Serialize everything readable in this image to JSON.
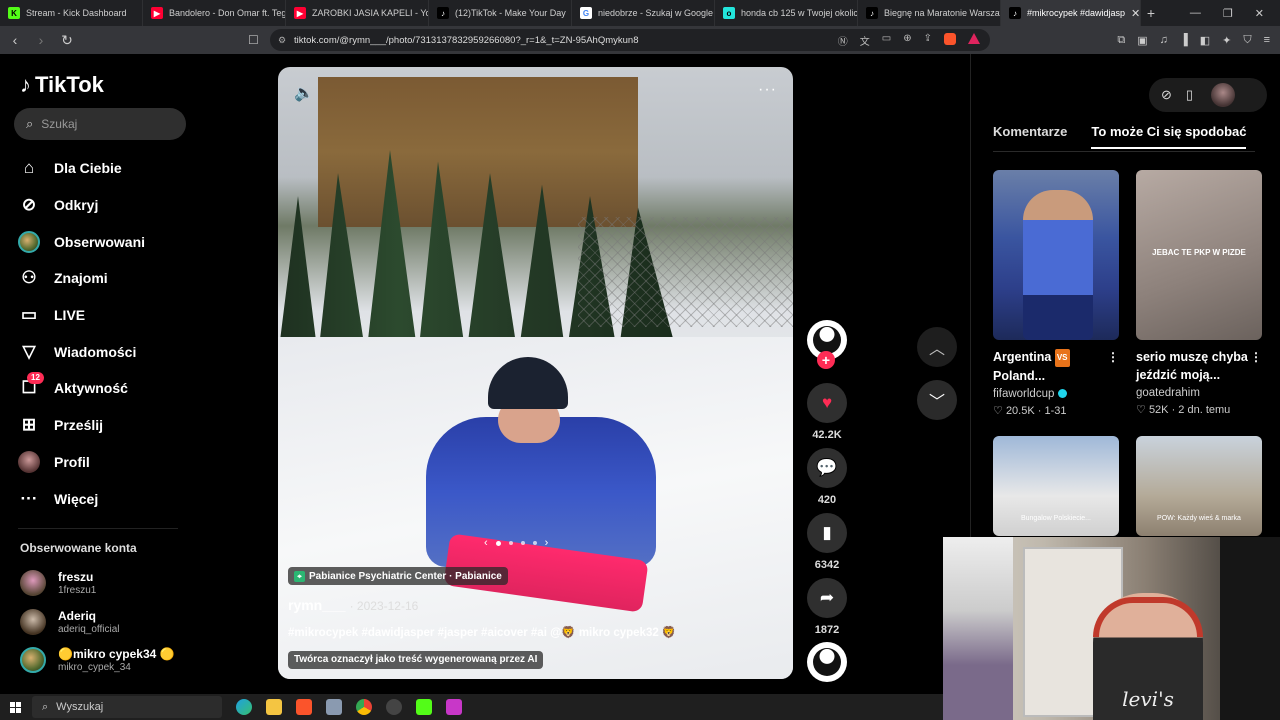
{
  "browser": {
    "tabs": [
      {
        "title": "Stream - Kick Dashboard",
        "color": "#53fc18",
        "glyph": "K"
      },
      {
        "title": "Bandolero - Don Omar ft. Tego",
        "color": "#ff0033",
        "glyph": "▶"
      },
      {
        "title": "ZAROBKI JASIA KAPELI - YouTu",
        "color": "#ff0033",
        "glyph": "▶"
      },
      {
        "title": "(12)TikTok - Make Your Day",
        "color": "#000000",
        "glyph": "♪"
      },
      {
        "title": "niedobrze - Szukaj w Google",
        "color": "#ffffff",
        "glyph": "G"
      },
      {
        "title": "honda cb 125 w Twojej okolicy",
        "color": "#23e5db",
        "glyph": "o"
      },
      {
        "title": "Biegnę na Maratonie Warszaw",
        "color": "#000000",
        "glyph": "♪"
      },
      {
        "title": "#mikrocypek #dawidjasp",
        "color": "#000000",
        "glyph": "♪",
        "active": true
      }
    ],
    "url": "tiktok.com/@rymn___/photo/7313137832959266080?_r=1&_t=ZN-95AhQmykun8"
  },
  "sidebar": {
    "logo": "TikTok",
    "search_placeholder": "Szukaj",
    "nav": [
      {
        "label": "Dla Ciebie",
        "icon": "home-icon"
      },
      {
        "label": "Odkryj",
        "icon": "compass-icon"
      },
      {
        "label": "Obserwowani",
        "icon": "following-avatar-icon"
      },
      {
        "label": "Znajomi",
        "icon": "friends-icon"
      },
      {
        "label": "LIVE",
        "icon": "live-icon"
      },
      {
        "label": "Wiadomości",
        "icon": "messages-icon"
      },
      {
        "label": "Aktywność",
        "icon": "activity-icon",
        "badge": "12"
      },
      {
        "label": "Prześlij",
        "icon": "upload-icon"
      },
      {
        "label": "Profil",
        "icon": "profile-avatar-icon"
      },
      {
        "label": "Więcej",
        "icon": "more-icon"
      }
    ],
    "followed_title": "Obserwowane konta",
    "followed": [
      {
        "name": "freszu",
        "handle": "1freszu1"
      },
      {
        "name": "Aderiq",
        "handle": "aderiq_official"
      },
      {
        "name": "🟡mikro cypek34 🟡",
        "handle": "mikro_cypek_34"
      }
    ]
  },
  "post": {
    "location": "Pabianice Psychiatric Center · Pabianice",
    "author": "rymn___",
    "date": "· 2023-12-16",
    "description": "#mikrocypek #dawidjasper #jasper #aicover #ai @🦁 mikro cypek32 🦁",
    "ai_label": "Twórca oznaczył jako treść wygenerowaną przez AI",
    "likes": "42.2K",
    "comments": "420",
    "saves": "6342",
    "shares": "1872"
  },
  "right_panel": {
    "tabs": [
      "Komentarze",
      "To może Ci się spodobać"
    ],
    "active_tab": 1,
    "cards": [
      {
        "title_a": "Argentina",
        "vs": "VS",
        "title_b": "Poland...",
        "author": "fifaworldcup",
        "verified": true,
        "likes": "20.5K",
        "when": "1-31"
      },
      {
        "title_a": "serio muszę chyba",
        "title_b": "jeździć moją...",
        "author": "goatedrahim",
        "likes": "52K",
        "when": "2 dn. temu",
        "overlay": "JEBAC TE PKP W PIZDE"
      },
      {
        "overlay": "Bungalow Polskiecie..."
      },
      {
        "overlay": "POW: Każdy wieś & marka"
      }
    ]
  },
  "webcam": {
    "shirt_text": "levi's"
  },
  "taskbar": {
    "search_placeholder": "Wyszukaj"
  },
  "colors": {
    "accent": "#fe2c55",
    "background": "#000000"
  }
}
